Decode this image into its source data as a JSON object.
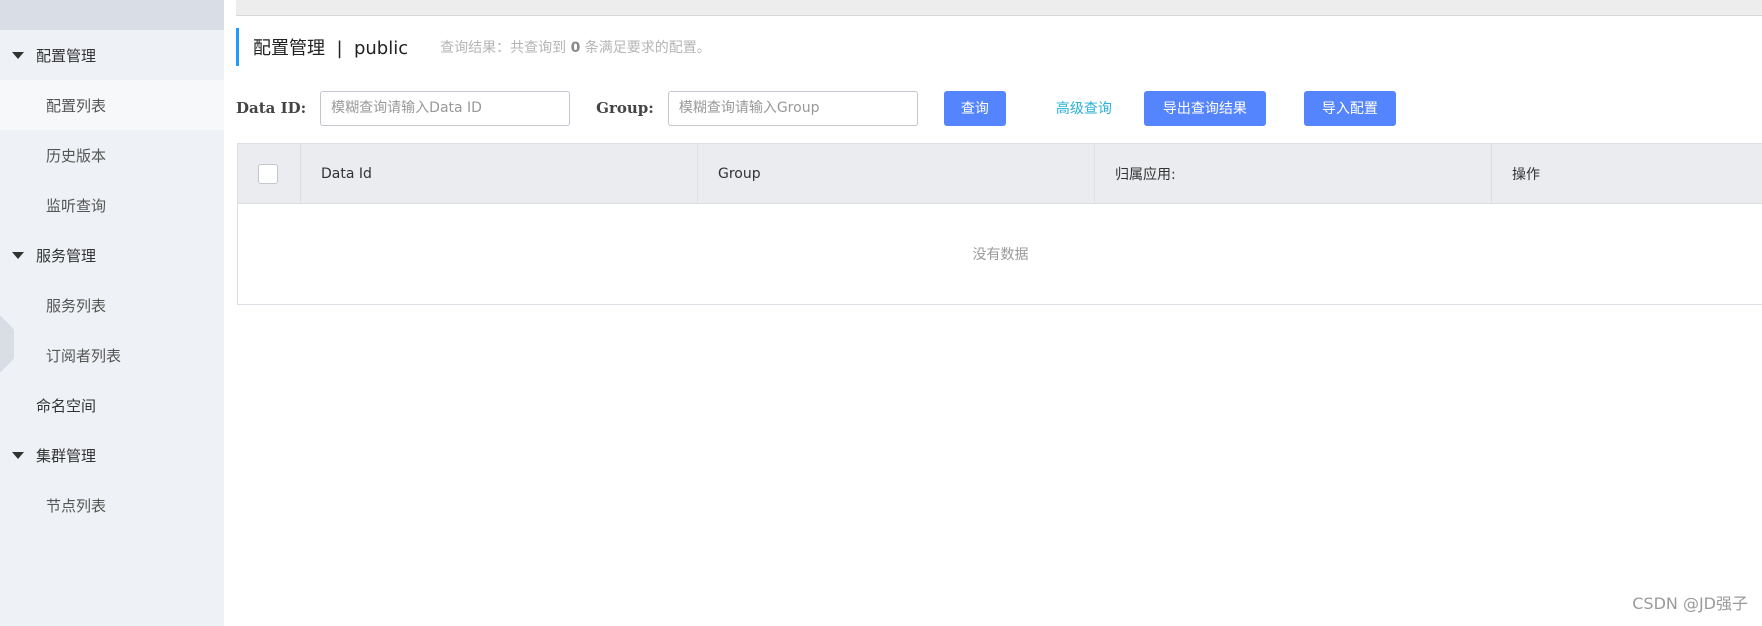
{
  "sidebar": {
    "groups": [
      {
        "label": "配置管理",
        "items": [
          "配置列表",
          "历史版本",
          "监听查询"
        ]
      },
      {
        "label": "服务管理",
        "items": [
          "服务列表",
          "订阅者列表"
        ]
      },
      {
        "label": "命名空间"
      },
      {
        "label": "集群管理",
        "items": [
          "节点列表"
        ]
      }
    ]
  },
  "header": {
    "title": "配置管理  |  public",
    "summary_prefix": "查询结果：共查询到",
    "summary_count": "0",
    "summary_suffix": "条满足要求的配置。"
  },
  "filters": {
    "dataid_label": "Data ID:",
    "dataid_placeholder": "模糊查询请输入Data ID",
    "group_label": "Group:",
    "group_placeholder": "模糊查询请输入Group",
    "query_button": "查询",
    "advanced_link": "高级查询",
    "export_button": "导出查询结果",
    "import_button": "导入配置"
  },
  "table": {
    "columns": [
      "Data Id",
      "Group",
      "归属应用:",
      "操作"
    ],
    "empty_text": "没有数据"
  },
  "watermark": "CSDN @JD强子",
  "colors": {
    "accent": "#5584ff",
    "link": "#29b0d8",
    "header_bar": "#209bfa"
  }
}
